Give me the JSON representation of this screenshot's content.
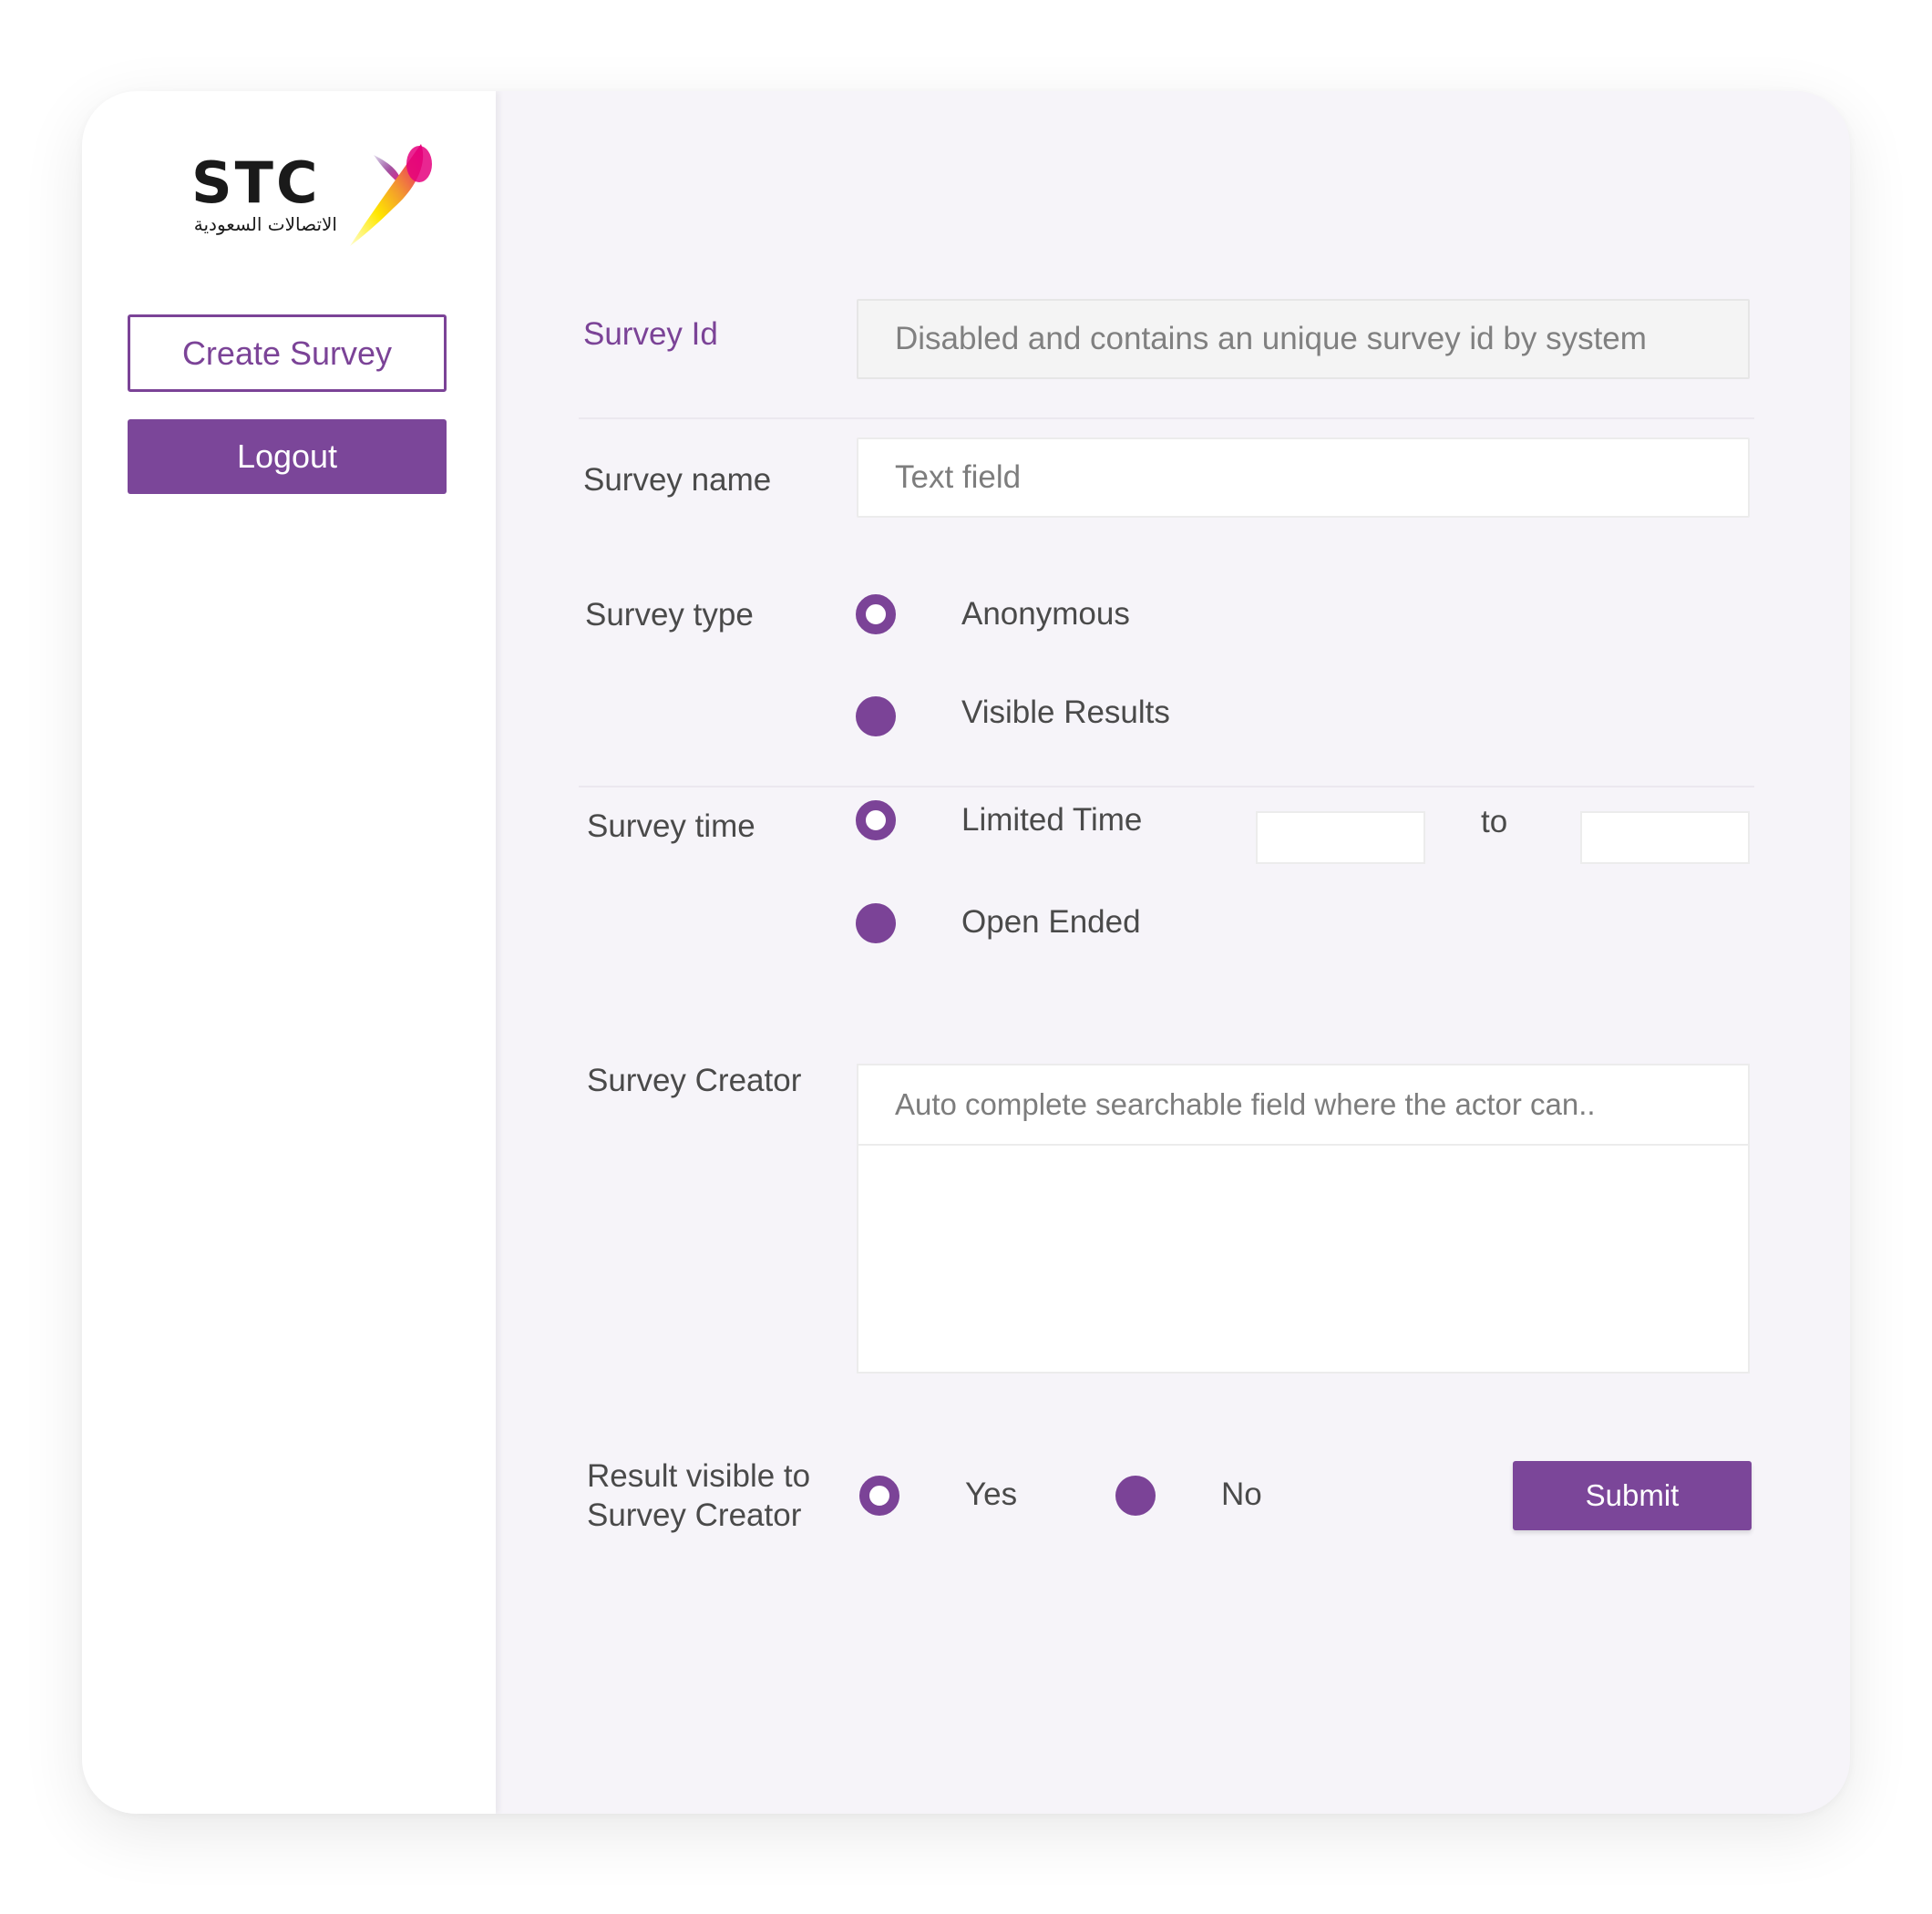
{
  "brand": {
    "logo_text": "STC",
    "logo_arabic": "الاتصالات السعودية"
  },
  "sidebar": {
    "create_survey_label": "Create Survey",
    "logout_label": "Logout"
  },
  "form": {
    "survey_id": {
      "label": "Survey Id",
      "value": "Disabled and contains an unique survey id by system"
    },
    "survey_name": {
      "label": "Survey name",
      "placeholder": "Text field"
    },
    "survey_type": {
      "label": "Survey type",
      "options": [
        {
          "label": "Anonymous",
          "selected": true
        },
        {
          "label": "Visible Results",
          "selected": false
        }
      ]
    },
    "survey_time": {
      "label": "Survey time",
      "options": [
        {
          "label": "Limited Time",
          "selected": true
        },
        {
          "label": "Open Ended",
          "selected": false
        }
      ],
      "range_separator": "to",
      "from_value": "",
      "to_value": ""
    },
    "survey_creator": {
      "label": "Survey Creator",
      "placeholder": "Auto complete searchable field where the actor can.."
    },
    "result_visible": {
      "label_line1": "Result visible to",
      "label_line2": "Survey Creator",
      "options": [
        {
          "label": "Yes",
          "selected": true
        },
        {
          "label": "No",
          "selected": false
        }
      ]
    },
    "submit_label": "Submit"
  },
  "colors": {
    "accent": "#7b4397",
    "content_background": "#f6f4f9",
    "sidebar_background": "#ffffff"
  },
  "icons": {
    "logo": "stc-swoosh-logo",
    "radio_selected": "radio-ring",
    "radio_unselected": "radio-filled"
  }
}
